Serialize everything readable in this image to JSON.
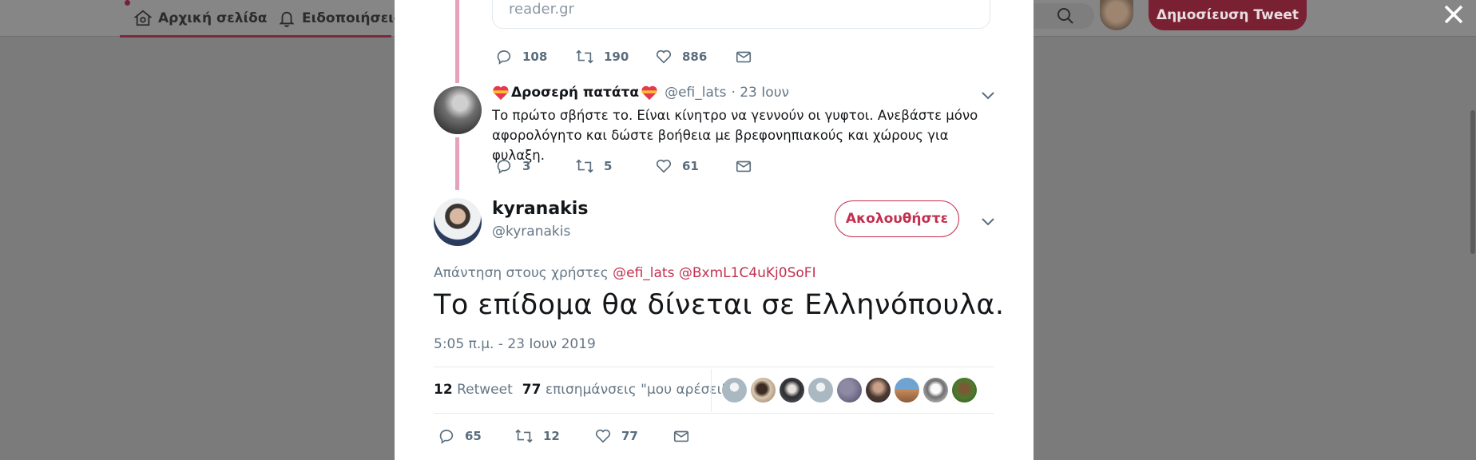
{
  "nav": {
    "home_label": "Αρχική σελίδα",
    "notifications_label": "Ειδοποιήσεις",
    "tweet_button": "Δημοσίευση Tweet"
  },
  "link_card": {
    "domain": "reader.gr"
  },
  "prev_tweet_actions": {
    "replies": "108",
    "retweets": "190",
    "likes": "886"
  },
  "reply": {
    "name": "Δροσερή πατάτα",
    "handle": "@efi_lats",
    "date": "· 23 Ιουν",
    "text": "Το πρώτο σβήστε το. Είναι κίνητρο να γεννούν οι γυφτοι. Ανεβάστε μόνο αφορολόγητο και δώστε βοήθεια με βρεφονηπιακούς και χώρους για φυλαξη.",
    "actions": {
      "replies": "3",
      "retweets": "5",
      "likes": "61"
    }
  },
  "main_tweet": {
    "name": "kyranakis",
    "handle": "@kyranakis",
    "follow_label": "Ακολουθήστε",
    "replying_prefix": "Απάντηση στους χρήστες",
    "replying_to_1": "@efi_lats",
    "replying_to_2": "@BxmL1C4uKj0SoFI",
    "text": "Το επίδομα θα δίνεται σε Ελληνόπουλα.",
    "timestamp": "5:05 π.μ. - 23 Ιουν 2019",
    "retweet_count": "12",
    "retweet_label": "Retweet",
    "like_count": "77",
    "like_label": "επισημάνσεις \"μου αρέσει\"",
    "actions": {
      "replies": "65",
      "retweets": "12",
      "likes": "77"
    }
  },
  "colors": {
    "accent": "#c2304f",
    "thread_line": "#e6a1bd",
    "muted": "#657786"
  }
}
